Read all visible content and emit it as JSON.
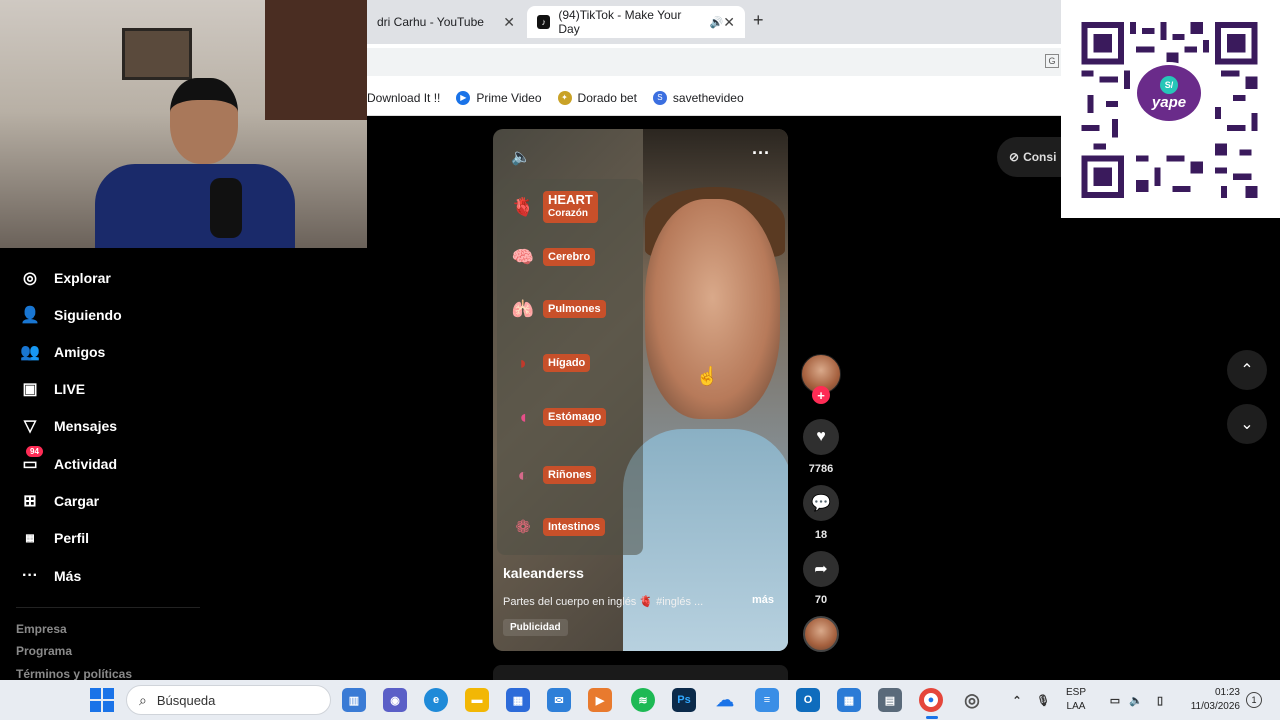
{
  "browser": {
    "tabs": [
      {
        "title": "dri Carhu - YouTube",
        "active": false
      },
      {
        "title": "(94)TikTok - Make Your Day",
        "active": true
      }
    ],
    "bookmarks": [
      {
        "label": "Download It !!",
        "icon": "download-icon"
      },
      {
        "label": "Prime Video",
        "icon": "prime-video-icon"
      },
      {
        "label": "Dorado bet",
        "icon": "dorado-icon"
      },
      {
        "label": "savethevideo",
        "icon": "savethevideo-icon"
      }
    ]
  },
  "sidebar": {
    "items": [
      {
        "label": "Explorar",
        "icon": "compass-icon"
      },
      {
        "label": "Siguiendo",
        "icon": "following-icon"
      },
      {
        "label": "Amigos",
        "icon": "friends-icon"
      },
      {
        "label": "LIVE",
        "icon": "live-icon"
      },
      {
        "label": "Mensajes",
        "icon": "messages-icon"
      },
      {
        "label": "Actividad",
        "icon": "activity-icon",
        "badge": "94"
      },
      {
        "label": "Cargar",
        "icon": "upload-icon"
      },
      {
        "label": "Perfil",
        "icon": "profile-icon"
      },
      {
        "label": "Más",
        "icon": "more-icon"
      }
    ],
    "footer": [
      "Empresa",
      "Programa",
      "Términos y políticas"
    ]
  },
  "video": {
    "organs": [
      {
        "label": "HEART",
        "sub": "Corazón",
        "icon": "heart-organ-icon"
      },
      {
        "label": "Cerebro",
        "icon": "brain-icon"
      },
      {
        "label": "Pulmones",
        "icon": "lungs-icon"
      },
      {
        "label": "Hígado",
        "icon": "liver-icon"
      },
      {
        "label": "Estómago",
        "icon": "stomach-icon"
      },
      {
        "label": "Riñones",
        "icon": "kidneys-icon"
      },
      {
        "label": "Intestinos",
        "icon": "intestines-icon"
      }
    ],
    "username": "kaleanderss",
    "description": "Partes del cuerpo en inglés 🫀 #inglés ...",
    "more": "más",
    "ad_label": "Publicidad"
  },
  "actions": {
    "likes": "7786",
    "comments": "18",
    "shares": "70"
  },
  "right_panel": {
    "consig_label": "Consi"
  },
  "qr": {
    "brand": "yape",
    "currency": "S/"
  },
  "taskbar": {
    "search_placeholder": "Búsqueda",
    "lang_line1": "ESP",
    "lang_line2": "LAA",
    "time": "01:23",
    "date": "11/03/2026",
    "notification": "1"
  },
  "colors": {
    "accent": "#fe2c55",
    "organ_label": "#c8502a",
    "yape_purple": "#6a2b8a"
  }
}
